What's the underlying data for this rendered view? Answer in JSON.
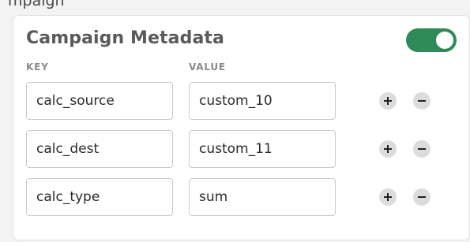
{
  "partial_header": "mpaign",
  "card": {
    "title": "Campaign Metadata",
    "toggle_on": true,
    "toggle_color": "#2e8b57"
  },
  "columns": {
    "key_label": "KEY",
    "value_label": "VALUE"
  },
  "rows": [
    {
      "key": "calc_source",
      "value": "custom_10"
    },
    {
      "key": "calc_dest",
      "value": "custom_11"
    },
    {
      "key": "calc_type",
      "value": "sum"
    }
  ],
  "icons": {
    "add": "plus-icon",
    "remove": "minus-icon"
  }
}
